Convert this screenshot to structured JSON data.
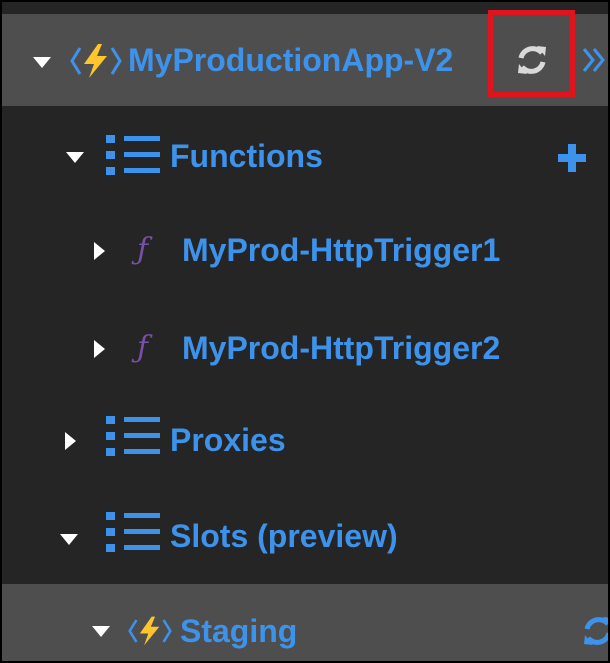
{
  "tree": {
    "app": {
      "label": "MyProductionApp-V2",
      "refresh_icon": "refresh-icon",
      "expand_icon": "double-chevron-right-icon"
    },
    "functions": {
      "label": "Functions",
      "add_icon": "plus-icon"
    },
    "functions_items": [
      {
        "label": "MyProd-HttpTrigger1",
        "icon": "function-f-icon"
      },
      {
        "label": "MyProd-HttpTrigger2",
        "icon": "function-f-icon"
      }
    ],
    "proxies": {
      "label": "Proxies"
    },
    "slots": {
      "label": "Slots (preview)"
    },
    "staging": {
      "label": "Staging",
      "refresh_icon": "refresh-icon"
    }
  },
  "colors": {
    "background": "#252526",
    "selected_row": "#4e4e4e",
    "text": "#3d93ec",
    "icon_blue": "#3d93ec",
    "lightning": "#ffc52e",
    "function_glyph": "#7a4fa8",
    "highlight": "#e0141e"
  }
}
